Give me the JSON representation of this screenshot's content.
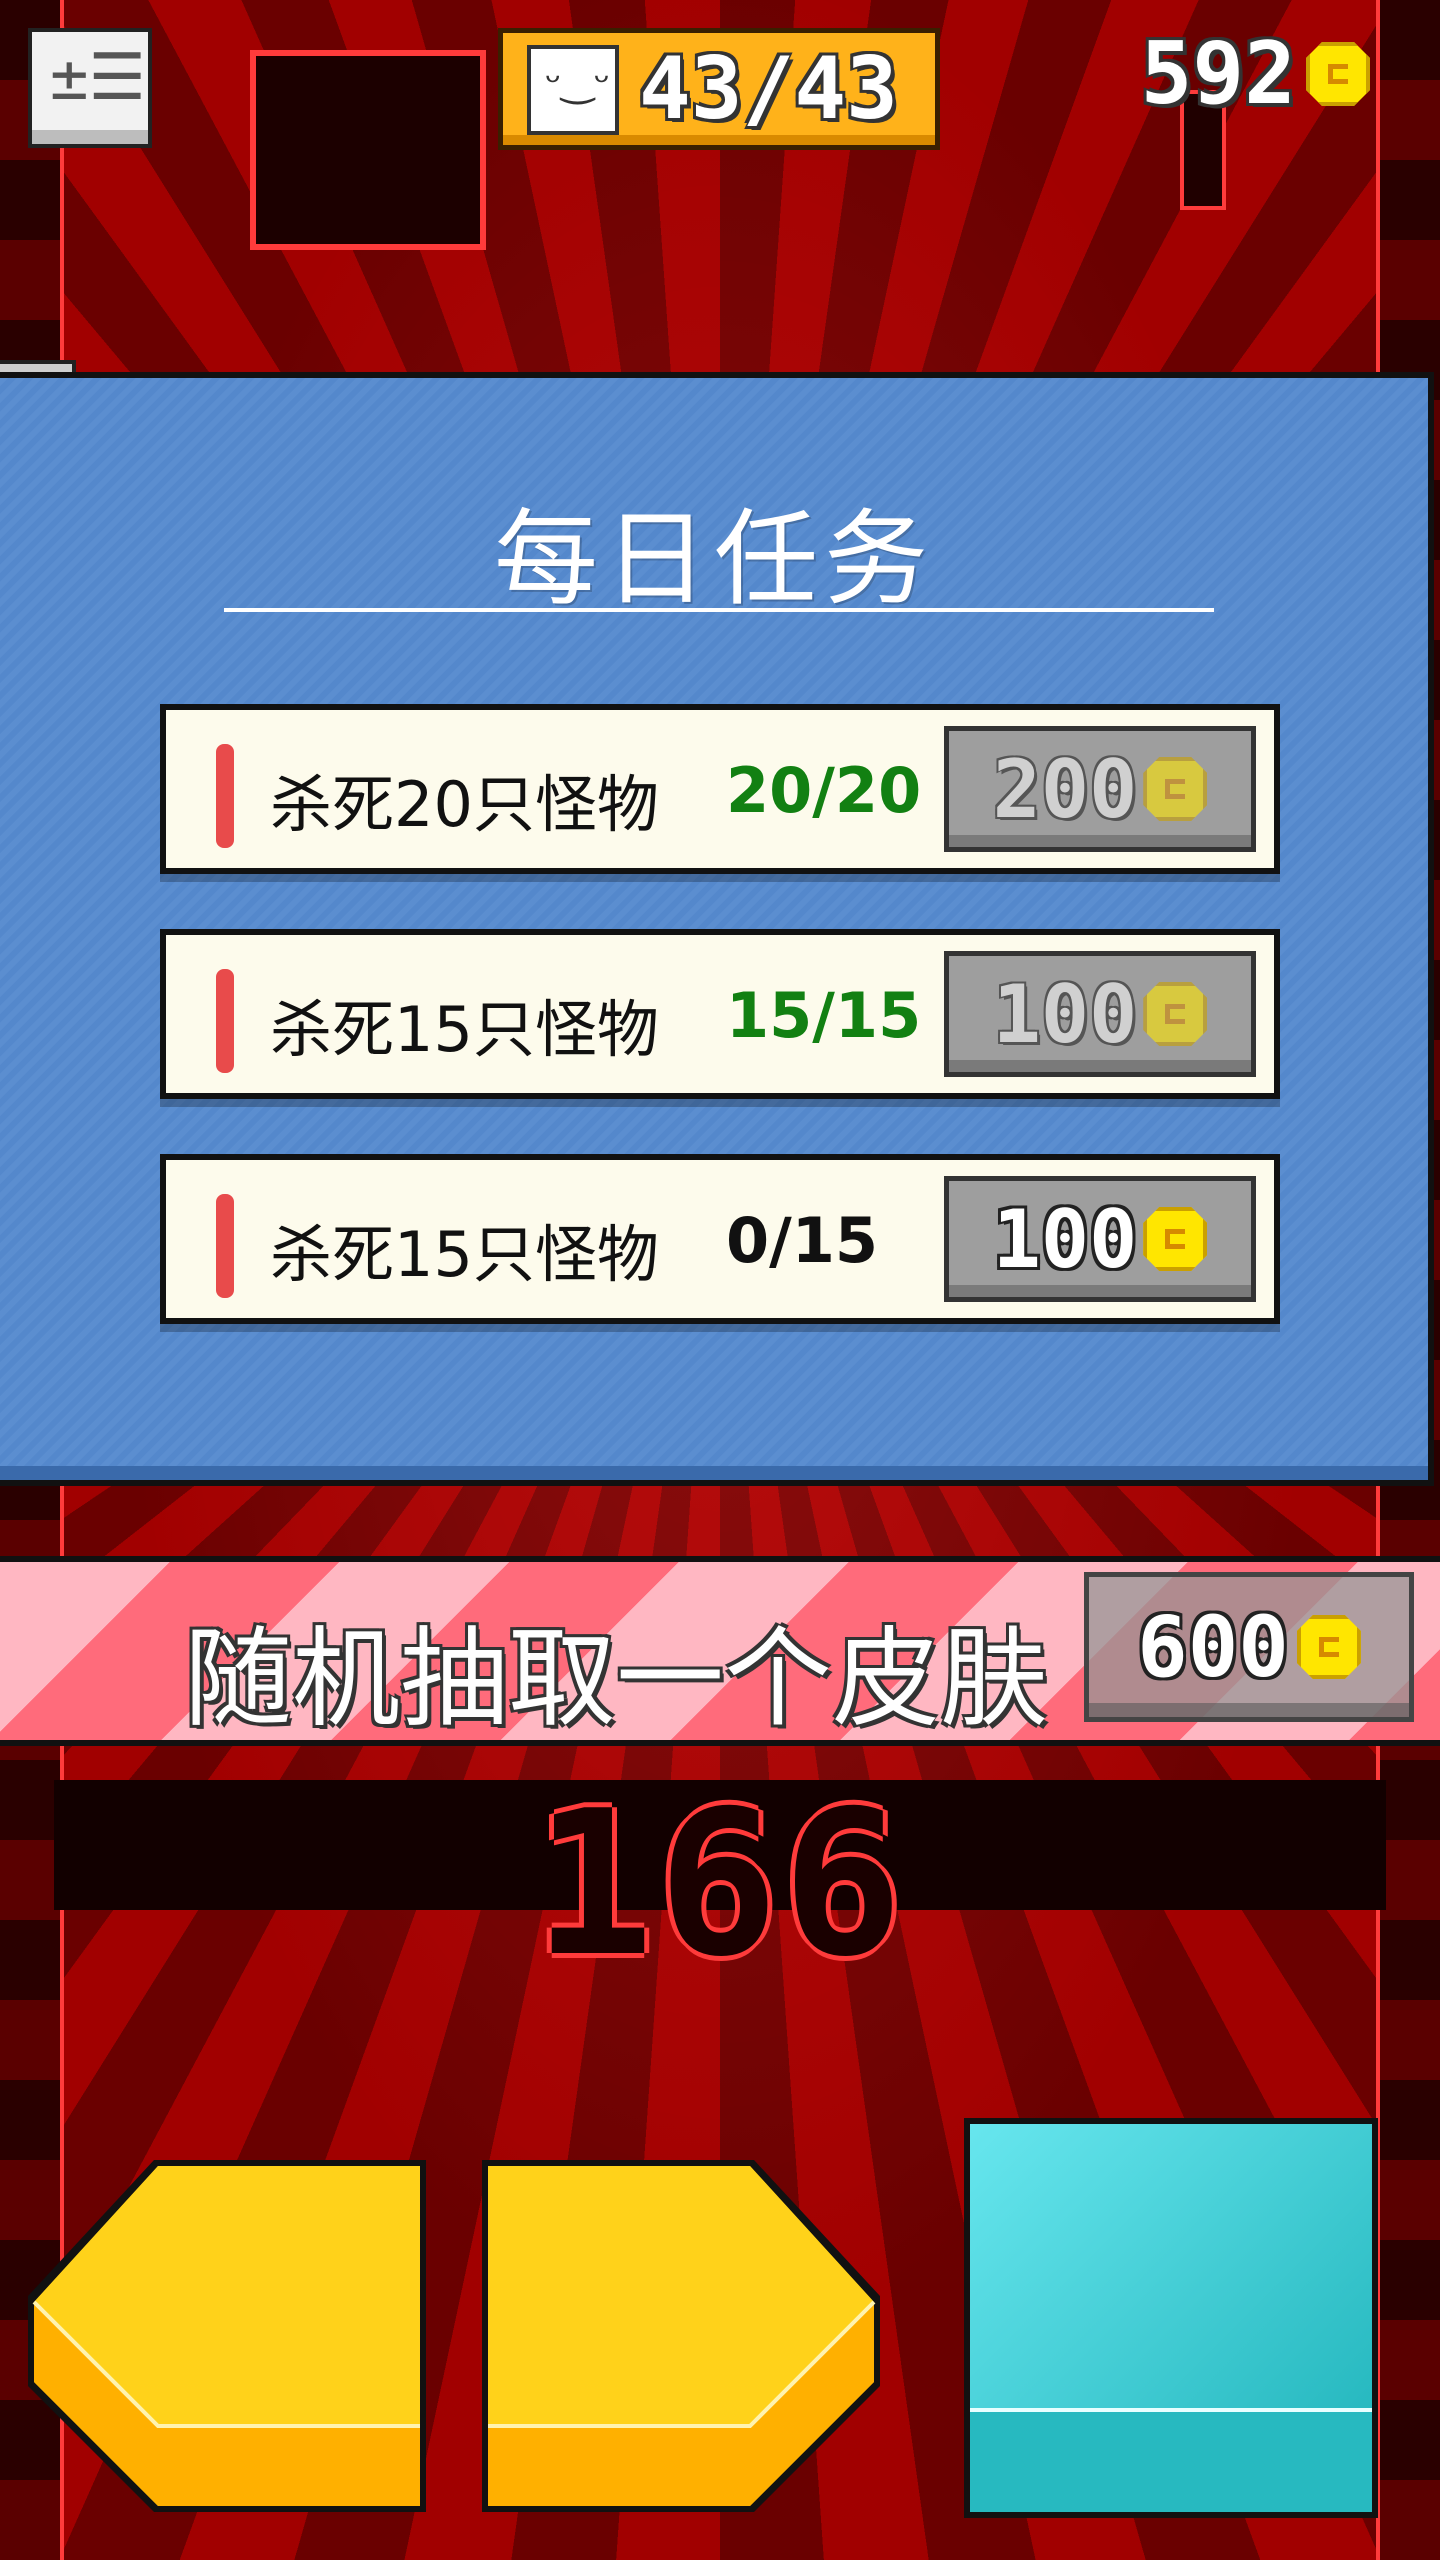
{
  "hud": {
    "menu_glyph": "±☰",
    "hp_face": "ᵕ‿ᵕ",
    "hp": "43/43",
    "coins": "592"
  },
  "daily_tasks": {
    "title": "每日任务",
    "tasks": [
      {
        "label": "杀死20只怪物",
        "progress": "20/20",
        "progress_color": "#128012",
        "reward": "200",
        "claimable": false
      },
      {
        "label": "杀死15只怪物",
        "progress": "15/15",
        "progress_color": "#128012",
        "reward": "100",
        "claimable": false
      },
      {
        "label": "杀死15只怪物",
        "progress": "0/15",
        "progress_color": "#111111",
        "reward": "100",
        "claimable": true
      }
    ]
  },
  "gacha": {
    "label": "随机抽取一个皮肤",
    "cost": "600"
  },
  "score": "166",
  "colors": {
    "panel": "#5b8ed0",
    "hp_box": "#ffb21a",
    "coin": "#ffe600",
    "control_yellow": "#ffc400",
    "action_teal": "#27b9c0"
  }
}
